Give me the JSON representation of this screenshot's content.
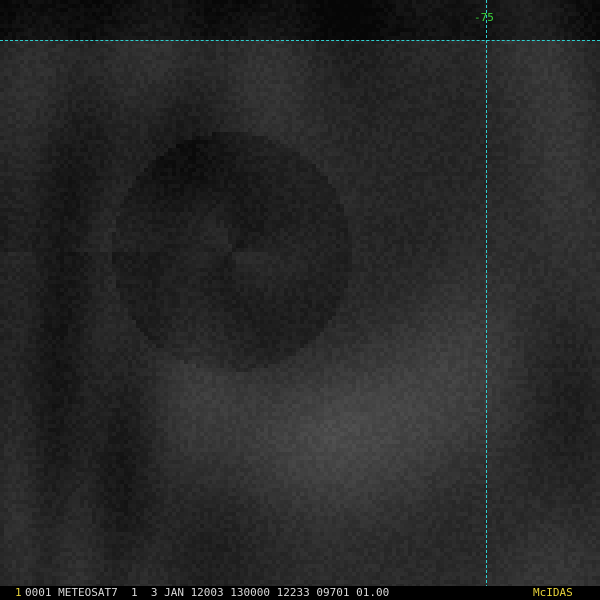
{
  "viewer": {
    "gridline_color": "#2fd0d0",
    "label_color": "#3bd43b",
    "longitude_label": "-75"
  },
  "status_bar": {
    "frame_number": "1",
    "info": "0001 METEOSAT7  1  3 JAN 12003 130000 12233 09701 01.00",
    "brand": "McIDAS",
    "highlight_color": "#e6d23a"
  }
}
